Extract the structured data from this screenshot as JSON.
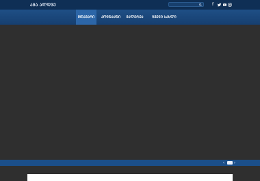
{
  "topbar": {
    "brand": "ᲐᲛᲐ ᲐᲚᲓᲕᲔ",
    "search": {
      "placeholder": ""
    },
    "social_icons": [
      "facebook-icon",
      "twitter-icon",
      "youtube-icon",
      "instagram-icon"
    ]
  },
  "nav": {
    "items": [
      {
        "label": "ᲛᲗᲐᲕᲐᲠᲘ",
        "active": true
      },
      {
        "label": "ᲙᲝᲜᲢᲐᲥᲢᲘ",
        "active": false
      },
      {
        "label": "ᲒᲐᲚᲔᲠᲔᲐ",
        "active": false
      },
      {
        "label": "ᲩᲕᲔᲜᲘ ᲡᲐᲮᲚᲘ",
        "active": false
      }
    ]
  },
  "slider": {
    "pager": {
      "prev": "‹",
      "next": "›"
    }
  },
  "colors": {
    "topbar": "#0f2f55",
    "nav": "#1f4f86",
    "active_nav": "#2c66a8",
    "hero_bg": "#2f2f2f",
    "bottombar": "#1b4f8a"
  }
}
